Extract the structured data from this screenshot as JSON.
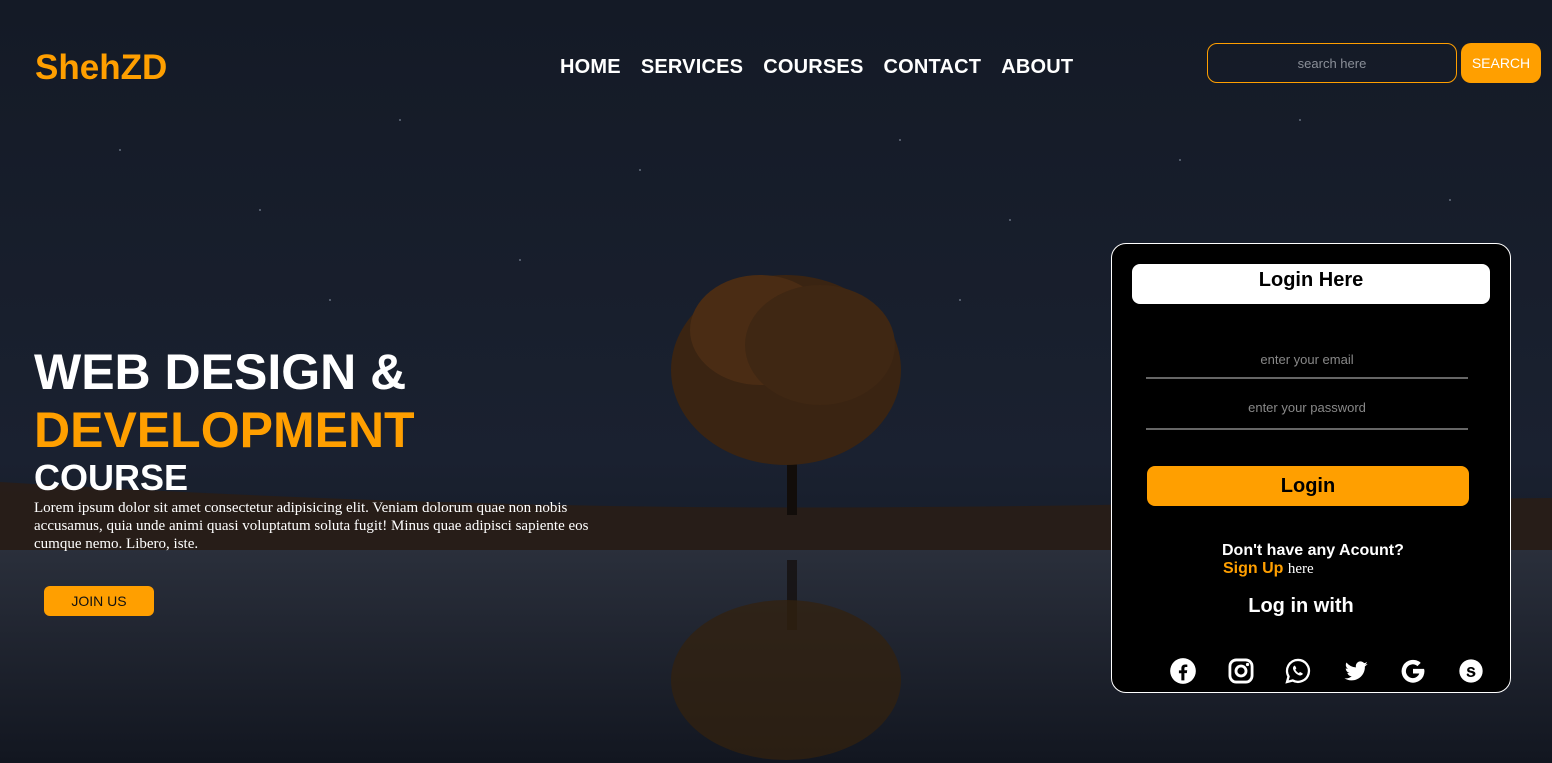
{
  "brand": {
    "name": "ShehZD",
    "accent": "#ff9f00"
  },
  "nav": {
    "items": [
      "HOME",
      "SERVICES",
      "COURSES",
      "CONTACT",
      "ABOUT"
    ]
  },
  "search": {
    "placeholder": "search here",
    "button_label": "SEARCH"
  },
  "hero": {
    "line1": "WEB DESIGN &",
    "line2": "DEVELOPMENT",
    "line3": "COURSE",
    "description": "Lorem ipsum dolor sit amet consectetur adipisicing elit. Veniam dolorum quae non nobis accusamus, quia unde animi quasi voluptatum soluta fugit! Minus quae adipisci sapiente eos cumque nemo. Libero, iste.",
    "cta_label": "JOIN US"
  },
  "login": {
    "title": "Login Here",
    "email_placeholder": "enter your email",
    "password_placeholder": "enter your password",
    "button_label": "Login",
    "no_account_text": "Don't have any Acount?",
    "signup_label": "Sign Up",
    "signup_suffix": "here",
    "login_with": "Log in with",
    "social_icons": [
      "facebook-icon",
      "instagram-icon",
      "whatsapp-icon",
      "twitter-icon",
      "google-icon",
      "skype-icon"
    ]
  }
}
